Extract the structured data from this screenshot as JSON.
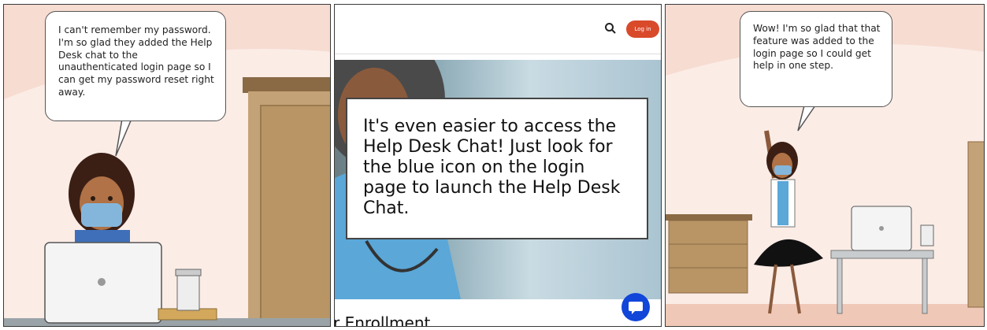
{
  "panel1": {
    "bubble_text": "I can't remember my password. I'm so glad they added the Help Desk chat to the unauthenticated login page so I can get my password reset right away."
  },
  "panel2": {
    "login_label": "Log in",
    "card_text": "It's even easier to access the Help Desk Chat! Just look for the blue icon on the login page to launch the Help Desk Chat.",
    "enrollment_text": "r Enrollment",
    "chat_icon": "chat-bubble-icon",
    "accent": "#d94a2b",
    "chat_color": "#1146d9"
  },
  "panel3": {
    "bubble_text": "Wow! I'm so glad that that feature was added to the login page so I could get help in one step."
  }
}
